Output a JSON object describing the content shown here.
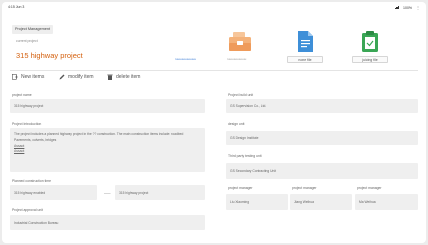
{
  "status_bar": {
    "time": "4:15 Jun 3",
    "battery": "100%"
  },
  "tag": "Project Management",
  "subtitle": "current project",
  "project_title": "315 highway project",
  "stats": {
    "first": "ruuuuuuuuuuuu",
    "second": "ruuuuuuuuuuu"
  },
  "tiles": [
    {
      "label": ""
    },
    {
      "label": "none file"
    },
    {
      "label": "juicing file"
    }
  ],
  "actions": [
    {
      "label": "New items"
    },
    {
      "label": "modify item"
    },
    {
      "label": "delete item"
    }
  ],
  "fields": {
    "project_name": {
      "label": "project name",
      "value": "315 highway project"
    },
    "project_intro": {
      "label": "Project Introduction",
      "lines": [
        "The project includes a planned highway project in the ?? construction. The main construction items include: roadbed",
        "Pavements, culverts, bridges"
      ],
      "links": [
        "Assaot",
        "Assaot"
      ]
    },
    "planned_construction": {
      "label": "Planned construction time",
      "start": "315 highway enabled",
      "end": "315 highway project"
    },
    "approval": {
      "label": "Project approval unit",
      "value": "Industrial Construction Bureau"
    },
    "build_unit": {
      "label": "Project build unit",
      "value": "GS Supervision Co., Ltd."
    },
    "design_unit": {
      "label": "design unit",
      "value": "GS Design Institute"
    },
    "third_party": {
      "label": "Third party testing unit",
      "value": "GS Secondary Contracting Unit"
    },
    "managers": [
      {
        "label": "project manager",
        "value": "Liu Xiaoming"
      },
      {
        "label": "project manager",
        "value": "Jiang Weihua"
      },
      {
        "label": "project manager",
        "value": "Ma Weihua"
      }
    ]
  },
  "colors": {
    "accent": "#d4600e",
    "link": "#3a7bd5",
    "tile_orange": "#f4b27a",
    "tile_blue": "#3e8fd8",
    "tile_green": "#3aa655"
  }
}
